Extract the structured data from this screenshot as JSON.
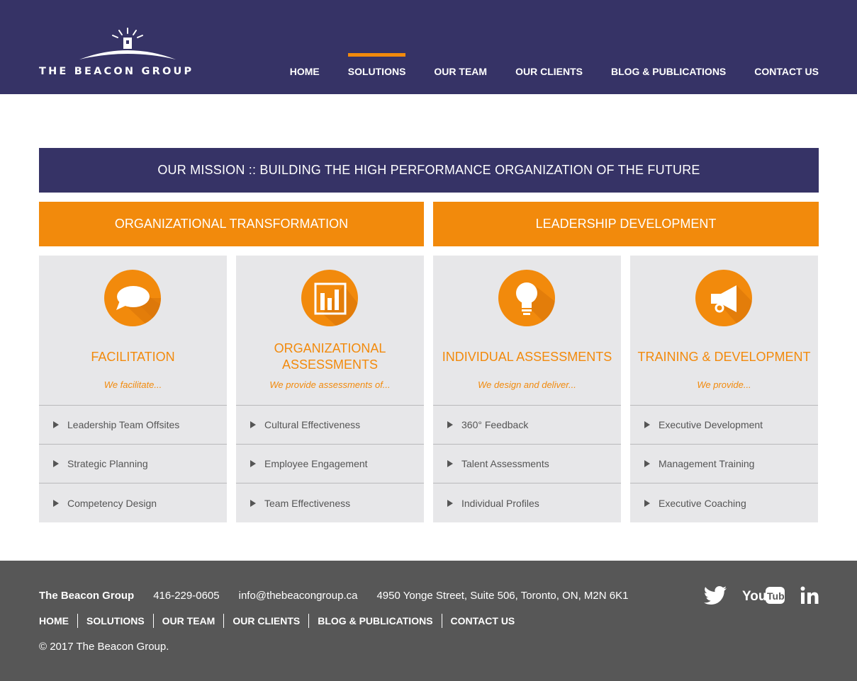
{
  "header": {
    "logo_text": "THE BEACON GROUP",
    "nav": [
      {
        "label": "HOME"
      },
      {
        "label": "SOLUTIONS"
      },
      {
        "label": "OUR TEAM"
      },
      {
        "label": "OUR CLIENTS"
      },
      {
        "label": "BLOG & PUBLICATIONS"
      },
      {
        "label": "CONTACT US"
      }
    ],
    "active_nav": "SOLUTIONS"
  },
  "mission": "OUR MISSION :: BUILDING THE HIGH PERFORMANCE ORGANIZATION OF THE FUTURE",
  "pillars": [
    "ORGANIZATIONAL TRANSFORMATION",
    "LEADERSHIP DEVELOPMENT"
  ],
  "cards": [
    {
      "icon": "speech-bubble-icon",
      "title": "FACILITATION",
      "subtitle": "We facilitate...",
      "items": [
        "Leadership Team Offsites",
        "Strategic Planning",
        "Competency Design"
      ]
    },
    {
      "icon": "bar-chart-icon",
      "title": "ORGANIZATIONAL ASSESSMENTS",
      "subtitle": "We provide assessments of...",
      "items": [
        "Cultural Effectiveness",
        "Employee Engagement",
        "Team Effectiveness"
      ]
    },
    {
      "icon": "lightbulb-icon",
      "title": "INDIVIDUAL ASSESSMENTS",
      "subtitle": "We design and deliver...",
      "items": [
        "360° Feedback",
        "Talent Assessments",
        "Individual Profiles"
      ]
    },
    {
      "icon": "megaphone-icon",
      "title": "TRAINING & DEVELOPMENT",
      "subtitle": "We provide...",
      "items": [
        "Executive Development",
        "Management Training",
        "Executive Coaching"
      ]
    }
  ],
  "footer": {
    "company": "The Beacon Group",
    "phone": "416-229-0605",
    "email": "info@thebeacongroup.ca",
    "address": "4950 Yonge Street, Suite 506, Toronto, ON, M2N 6K1",
    "nav": [
      "HOME",
      "SOLUTIONS",
      "OUR TEAM",
      "OUR CLIENTS",
      "BLOG & PUBLICATIONS",
      "CONTACT US"
    ],
    "copyright": "© 2017 The Beacon Group.",
    "social": [
      "twitter-icon",
      "youtube-icon",
      "linkedin-icon"
    ]
  },
  "colors": {
    "navy": "#363366",
    "orange": "#f28a0c",
    "card_bg": "#e7e7e9",
    "footer_bg": "#575757"
  }
}
